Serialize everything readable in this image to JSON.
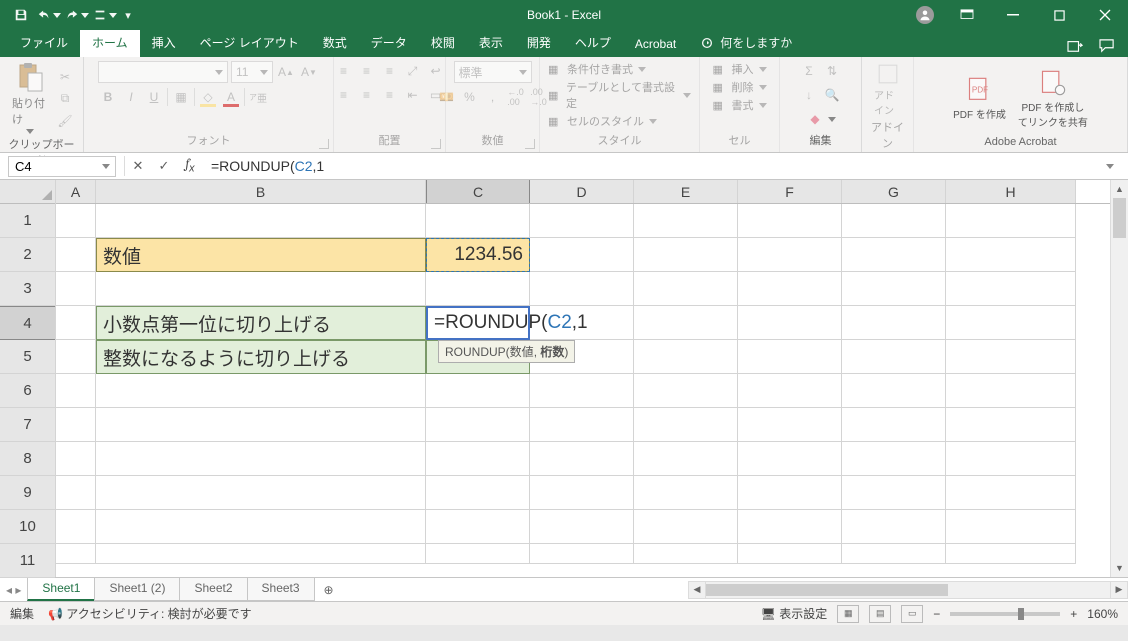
{
  "title": "Book1  -  Excel",
  "tabs": {
    "file": "ファイル",
    "home": "ホーム",
    "insert": "挿入",
    "layout": "ページ レイアウト",
    "formulas": "数式",
    "data": "データ",
    "review": "校閲",
    "view": "表示",
    "dev": "開発",
    "help": "ヘルプ",
    "acrobat": "Acrobat",
    "tellme": "何をしますか"
  },
  "ribbon": {
    "clipboard": {
      "label": "クリップボード",
      "paste": "貼り付け"
    },
    "font": {
      "label": "フォント",
      "size": "11",
      "bold": "B",
      "italic": "I",
      "underline": "U",
      "a1": "A",
      "a2": "A",
      "a3": "A"
    },
    "align": {
      "label": "配置"
    },
    "number": {
      "label": "数値",
      "style": "標準",
      "decInc": ".0",
      "decDec": ".00"
    },
    "styles": {
      "label": "スタイル",
      "cond": "条件付き書式",
      "table": "テーブルとして書式設定",
      "cell": "セルのスタイル"
    },
    "cells": {
      "label": "セル",
      "ins": "挿入",
      "del": "削除",
      "fmt": "書式"
    },
    "editing": {
      "label": "編集"
    },
    "addin": {
      "label": "アドイン",
      "btn": "アドイン"
    },
    "acrobat": {
      "label": "Adobe Acrobat",
      "create": "PDF を作成",
      "share": "PDF を作成してリンクを共有"
    }
  },
  "formula_bar": {
    "namebox": "C4",
    "text_prefix": "=ROUNDUP(",
    "ref": "C2",
    "text_suffix": ",1"
  },
  "cols": [
    "A",
    "B",
    "C",
    "D",
    "E",
    "F",
    "G",
    "H"
  ],
  "rows": [
    "1",
    "2",
    "3",
    "4",
    "5",
    "6",
    "7",
    "8",
    "9",
    "10",
    "11"
  ],
  "cells": {
    "B2": "数値",
    "C2": "1234.56",
    "B4": "小数点第一位に切り上げる",
    "B5": "整数になるように切り上げる",
    "C4_prefix": "=ROUNDUP(",
    "C4_ref": "C2",
    "C4_suffix": ",1"
  },
  "tooltip": {
    "fn": "ROUNDUP(",
    "a1": "数値",
    "sep": ", ",
    "a2": "桁数",
    "end": ")"
  },
  "sheets": {
    "s1": "Sheet1",
    "s2": "Sheet1 (2)",
    "s3": "Sheet2",
    "s4": "Sheet3"
  },
  "status": {
    "mode": "編集",
    "acc": "アクセシビリティ: 検討が必要です",
    "display": "表示設定",
    "zoom": "160%"
  }
}
